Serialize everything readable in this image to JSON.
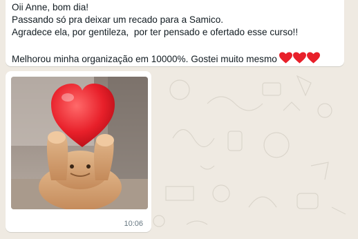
{
  "message": {
    "lines": [
      "Oii Anne, bom dia!",
      "Passando só pra deixar um recado para a Samico.",
      "Agradece ela, por gentileza,  por ter pensado e ofertado esse curso!!",
      "Melhorou minha organização em 10000%. Gostei muito mesmo"
    ],
    "emoji": [
      "red-heart-icon",
      "red-heart-icon",
      "red-heart-icon"
    ]
  },
  "sticker": {
    "icon": "red-heart-icon",
    "subject": "cat-icon",
    "time": "10:06"
  },
  "colors": {
    "chat_background": "#efeae2",
    "bubble": "#ffffff",
    "text": "#111b21",
    "timestamp": "#667781",
    "heart": "#e8202a"
  }
}
